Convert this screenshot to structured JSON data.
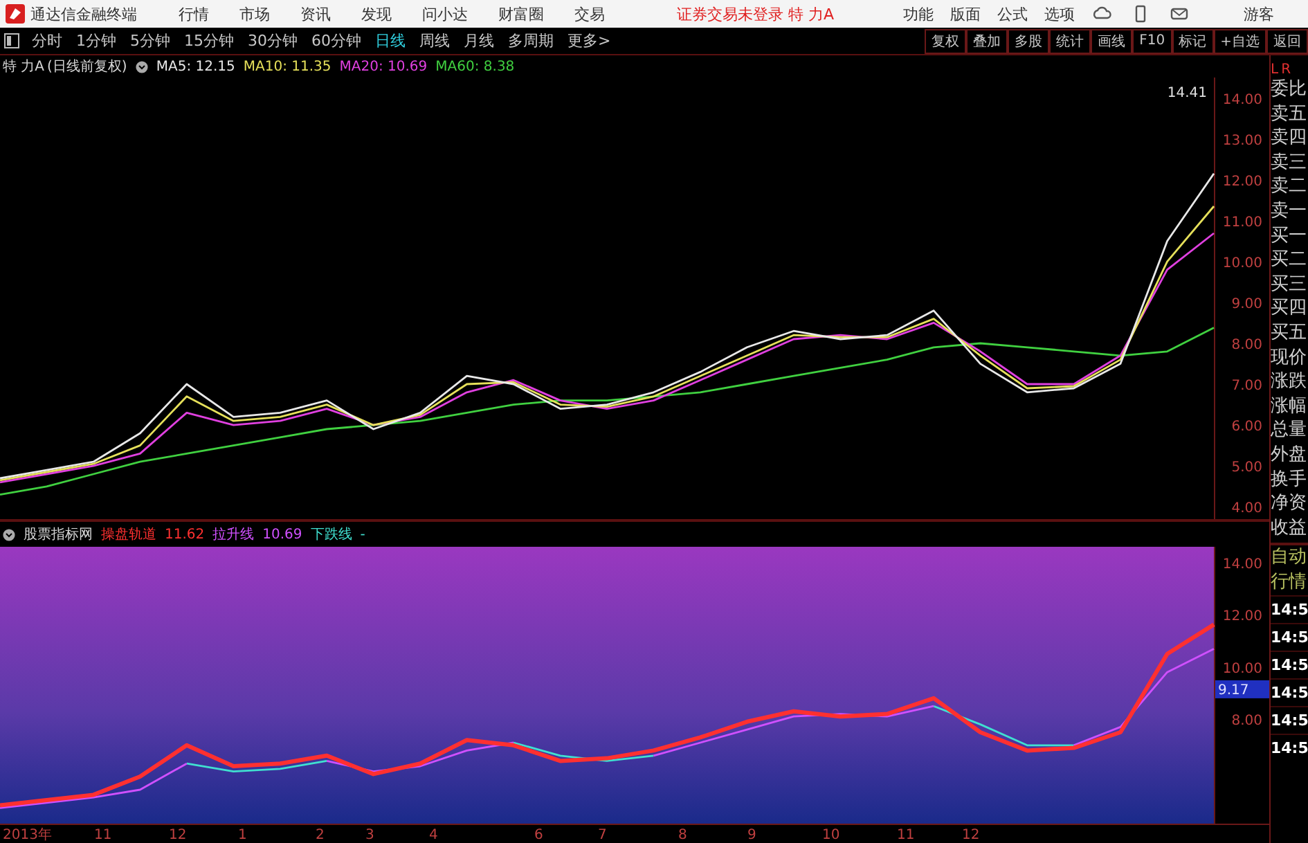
{
  "app_bar": {
    "title": "通达信金融终端",
    "menus": [
      "行情",
      "市场",
      "资讯",
      "发现",
      "问小达",
      "财富圈",
      "交易"
    ],
    "notice": "证券交易未登录 特 力A",
    "tools": [
      "功能",
      "版面",
      "公式",
      "选项"
    ],
    "user": "游客"
  },
  "period_tabs": [
    {
      "label": "分时",
      "selected": false
    },
    {
      "label": "1分钟",
      "selected": false
    },
    {
      "label": "5分钟",
      "selected": false
    },
    {
      "label": "15分钟",
      "selected": false
    },
    {
      "label": "30分钟",
      "selected": false
    },
    {
      "label": "60分钟",
      "selected": false
    },
    {
      "label": "日线",
      "selected": true
    },
    {
      "label": "周线",
      "selected": false
    },
    {
      "label": "月线",
      "selected": false
    },
    {
      "label": "多周期",
      "selected": false
    },
    {
      "label": "更多>",
      "selected": false
    }
  ],
  "chart_buttons": [
    "复权",
    "叠加",
    "多股",
    "统计",
    "画线",
    "F10",
    "标记",
    "+自选",
    "返回"
  ],
  "main_chart": {
    "stock": "特 力A",
    "mode": "(日线前复权)",
    "legend_values": [
      ": 12.15",
      ": 11.35",
      ": 10.69",
      ": 8.38"
    ],
    "high_label": "14.41",
    "chart_data": {
      "type": "line",
      "ylim": [
        3.7,
        14.5
      ],
      "yticks": [
        {
          "value": 14,
          "label": "14.00"
        },
        {
          "value": 13,
          "label": "13.00"
        },
        {
          "value": 12,
          "label": "12.00"
        },
        {
          "value": 11,
          "label": "11.00"
        },
        {
          "value": 10,
          "label": "10.00"
        },
        {
          "value": 9,
          "label": "9.00"
        },
        {
          "value": 8,
          "label": "8.00"
        },
        {
          "value": 7,
          "label": "7.00"
        },
        {
          "value": 6,
          "label": "6.00"
        },
        {
          "value": 5,
          "label": "5.00"
        },
        {
          "value": 4,
          "label": "4.00"
        }
      ],
      "series": [
        {
          "name": "MA5",
          "color": "#e8e8e8",
          "values": [
            4.7,
            4.9,
            5.1,
            5.8,
            7.0,
            6.2,
            6.3,
            6.6,
            5.9,
            6.3,
            7.2,
            7.0,
            6.4,
            6.5,
            6.8,
            7.3,
            7.9,
            8.3,
            8.1,
            8.2,
            8.8,
            7.5,
            6.8,
            6.9,
            7.5,
            10.5,
            12.15
          ]
        },
        {
          "name": "MA10",
          "color": "#e6e05a",
          "values": [
            4.65,
            4.85,
            5.05,
            5.5,
            6.7,
            6.1,
            6.2,
            6.5,
            6.0,
            6.25,
            7.0,
            7.05,
            6.5,
            6.45,
            6.7,
            7.2,
            7.7,
            8.2,
            8.15,
            8.15,
            8.6,
            7.7,
            6.9,
            6.95,
            7.6,
            10.0,
            11.35
          ]
        },
        {
          "name": "MA20",
          "color": "#e040e0",
          "values": [
            4.6,
            4.8,
            5.0,
            5.3,
            6.3,
            6.0,
            6.1,
            6.4,
            6.0,
            6.2,
            6.8,
            7.1,
            6.6,
            6.4,
            6.6,
            7.1,
            7.6,
            8.1,
            8.2,
            8.1,
            8.5,
            7.8,
            7.0,
            7.0,
            7.7,
            9.8,
            10.69
          ]
        },
        {
          "name": "MA60",
          "color": "#40d040",
          "values": [
            4.3,
            4.5,
            4.8,
            5.1,
            5.3,
            5.5,
            5.7,
            5.9,
            6.0,
            6.1,
            6.3,
            6.5,
            6.6,
            6.6,
            6.7,
            6.8,
            7.0,
            7.2,
            7.4,
            7.6,
            7.9,
            8.0,
            7.9,
            7.8,
            7.7,
            7.8,
            8.38
          ]
        }
      ]
    }
  },
  "indicator_chart": {
    "name": "股票指标网",
    "legend_values": [
      "11.62",
      "10.69",
      "-"
    ],
    "cursor_label": "9.17",
    "chart_data": {
      "type": "line",
      "ylim": [
        4,
        14.6
      ],
      "yticks": [
        {
          "value": 14,
          "label": "14.00"
        },
        {
          "value": 12,
          "label": "12.00"
        },
        {
          "value": 10,
          "label": "10.00"
        },
        {
          "value": 8,
          "label": "8.00"
        }
      ],
      "series": [
        {
          "name": "操盘轨道",
          "color": "#ff3030",
          "values": [
            4.7,
            4.9,
            5.1,
            5.8,
            7.0,
            6.2,
            6.3,
            6.6,
            5.9,
            6.3,
            7.2,
            7.0,
            6.4,
            6.5,
            6.8,
            7.3,
            7.9,
            8.3,
            8.1,
            8.2,
            8.8,
            7.5,
            6.8,
            6.9,
            7.5,
            10.5,
            11.62
          ]
        },
        {
          "name": "拉升线",
          "color": "#d050ff",
          "values": [
            4.6,
            4.8,
            5.0,
            5.3,
            6.3,
            null,
            null,
            6.4,
            6.0,
            6.2,
            6.8,
            7.1,
            null,
            null,
            6.6,
            7.1,
            7.6,
            8.1,
            8.2,
            8.1,
            8.5,
            null,
            null,
            7.0,
            7.7,
            9.8,
            10.69
          ]
        },
        {
          "name": "下跌线",
          "color": "#40e0d0",
          "values": [
            null,
            null,
            null,
            null,
            6.3,
            6.0,
            6.1,
            6.4,
            null,
            null,
            null,
            7.1,
            6.6,
            6.4,
            6.6,
            null,
            null,
            null,
            null,
            null,
            8.5,
            7.8,
            7.0,
            7.0,
            null,
            null,
            null
          ]
        }
      ]
    },
    "x_labels": [
      "2013年",
      "11",
      "12",
      "1",
      "2",
      "3",
      "4",
      "6",
      "7",
      "8",
      "9",
      "10",
      "11",
      "12"
    ]
  },
  "side_panel": {
    "corner_left": "L",
    "corner_right": "R",
    "quote_labels": [
      "委比",
      "卖五",
      "卖四",
      "卖三",
      "卖二",
      "卖一",
      "买一",
      "买二",
      "买三",
      "买四",
      "买五",
      "现价",
      "涨跌",
      "涨幅",
      "总量",
      "外盘",
      "换手",
      "净资",
      "收益"
    ],
    "auto_labels": [
      "自动",
      "行情"
    ],
    "times": [
      "14:5",
      "14:5",
      "14:5",
      "14:5",
      "14:5",
      "14:5"
    ]
  }
}
